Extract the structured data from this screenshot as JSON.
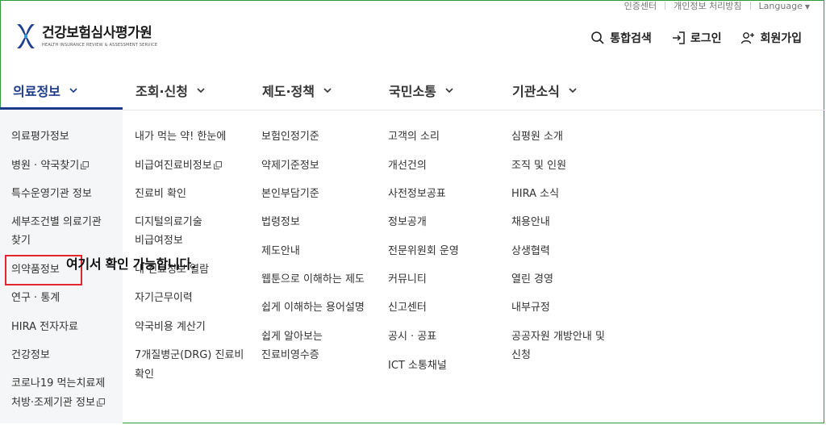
{
  "utility": {
    "cert": "인증센터",
    "privacy": "개인정보 처리방침",
    "language": "Language"
  },
  "logo": {
    "name": "건강보험심사평가원",
    "sub": "HEALTH INSURANCE REVIEW & ASSESSMENT SERVICE"
  },
  "actions": {
    "search": "통합검색",
    "login": "로그인",
    "join": "회원가입"
  },
  "gnb": [
    "의료정보",
    "조회·신청",
    "제도·정책",
    "국민소통",
    "기관소식"
  ],
  "menu": {
    "col1": [
      "의료평가정보",
      "병원 · 약국찾기",
      "특수운영기관 정보",
      "세부조건별 의료기관",
      "찾기",
      "의약품정보",
      "연구 · 통계",
      "HIRA 전자자료",
      "건강정보",
      "코로나19 먹는치료제",
      "처방·조제기관 정보"
    ],
    "col2": [
      "내가 먹는 약! 한눈에",
      "비급여진료비정보",
      "진료비 확인",
      "디지털의료기술",
      "비급여정보",
      "내 진료정보 열람",
      "자기근무이력",
      "약국비용 계산기",
      "7개질병군(DRG) 진료비",
      "확인"
    ],
    "col3": [
      "보험인정기준",
      "약제기준정보",
      "본인부담기준",
      "법령정보",
      "제도안내",
      "웹툰으로 이해하는 제도",
      "쉽게 이해하는 용어설명",
      "쉽게 알아보는",
      "진료비영수증"
    ],
    "col4": [
      "고객의 소리",
      "개선건의",
      "사전정보공표",
      "정보공개",
      "전문위원회 운영",
      "커뮤니티",
      "신고센터",
      "공시 · 공표",
      "ICT 소통채널"
    ],
    "col5": [
      "심평원 소개",
      "조직 및 인원",
      "HIRA 소식",
      "채용안내",
      "상생협력",
      "열린 경영",
      "내부규정",
      "공공자원 개방안내 및",
      "신청"
    ]
  },
  "annotation": "여기서 확인 가능합니다."
}
